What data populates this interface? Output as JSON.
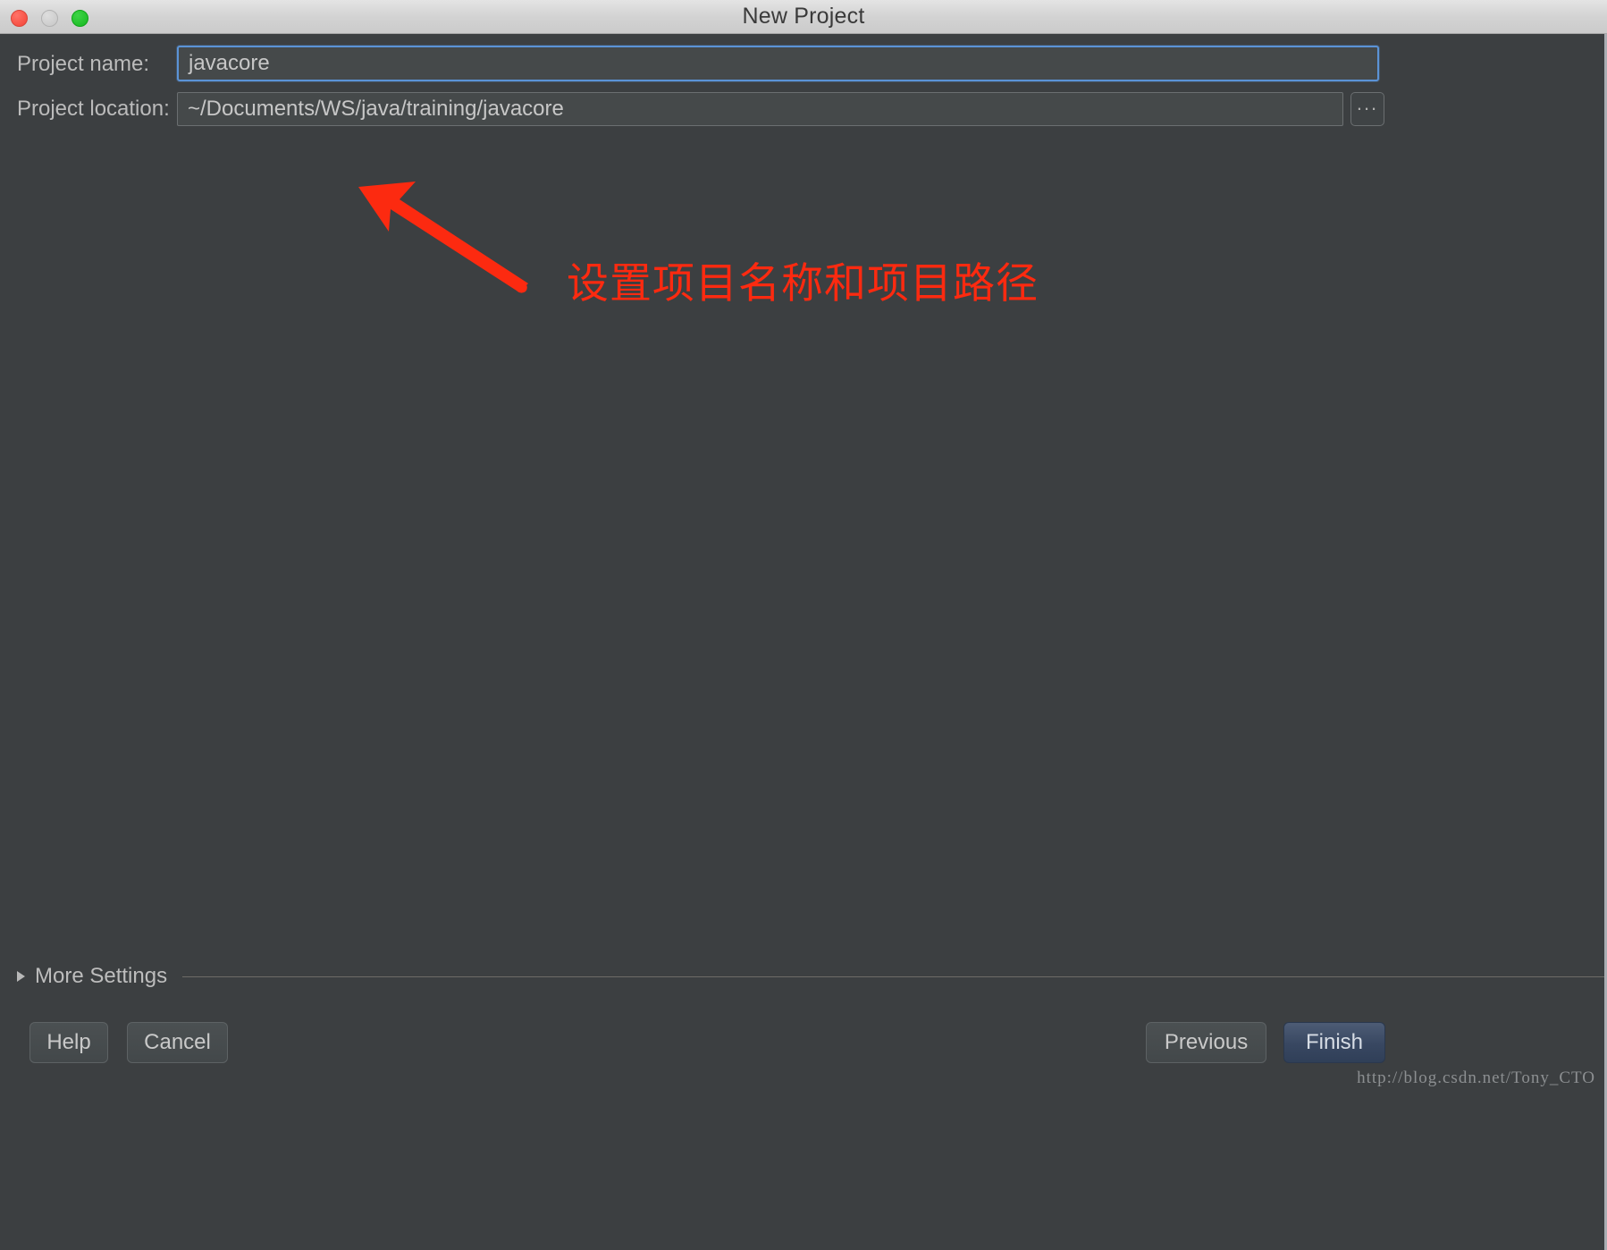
{
  "window": {
    "title": "New Project",
    "controls": {
      "close": "close-button",
      "minimize": "minimize-button",
      "maximize": "maximize-button"
    },
    "background_color": "#3c3f41",
    "titlebar_color": "#d3d3d3"
  },
  "form": {
    "project_name": {
      "label": "Project name:",
      "value": "javacore",
      "placeholder": "",
      "focused": true,
      "focus_color": "#5b93d6"
    },
    "project_location": {
      "label": "Project location:",
      "value": "~/Documents/WS/java/training/javacore",
      "placeholder": "",
      "browse_label": "..."
    }
  },
  "annotation": {
    "text": "设置项目名称和项目路径",
    "color": "#fc2a10",
    "arrow": "up-left-arrow"
  },
  "more_settings": {
    "label": "More Settings",
    "expanded": false,
    "chevron": "triangle-right-icon"
  },
  "buttons": {
    "help": "Help",
    "cancel": "Cancel",
    "previous": "Previous",
    "finish": "Finish",
    "finish_is_default": true,
    "finish_color": "#384761"
  },
  "watermark": {
    "text": "http://blog.csdn.net/Tony_CTO"
  }
}
